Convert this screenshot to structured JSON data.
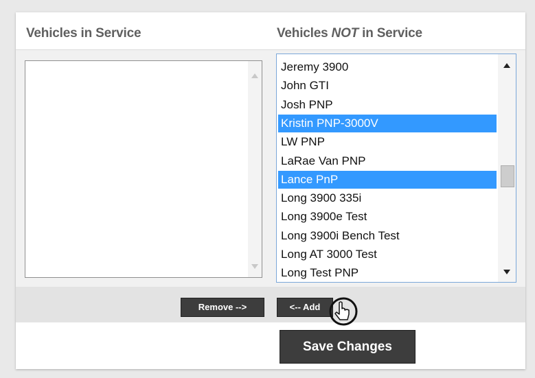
{
  "header": {
    "in_service_title": "Vehicles in Service",
    "not_in_service_prefix": "Vehicles ",
    "not_in_service_em": "NOT",
    "not_in_service_suffix": " in Service"
  },
  "in_service_list": {
    "items": []
  },
  "not_in_service_list": {
    "items": [
      {
        "label": "Jeremy 3900",
        "selected": false
      },
      {
        "label": "John GTI",
        "selected": false
      },
      {
        "label": "Josh PNP",
        "selected": false
      },
      {
        "label": "Kristin PNP-3000V",
        "selected": true
      },
      {
        "label": "LW PNP",
        "selected": false
      },
      {
        "label": "LaRae Van PNP",
        "selected": false
      },
      {
        "label": "Lance PnP",
        "selected": true
      },
      {
        "label": "Long 3900 335i",
        "selected": false
      },
      {
        "label": "Long 3900e Test",
        "selected": false
      },
      {
        "label": "Long 3900i Bench Test",
        "selected": false
      },
      {
        "label": "Long AT 3000 Test",
        "selected": false
      },
      {
        "label": "Long Test PNP",
        "selected": false
      }
    ],
    "selection_color": "#3399ff",
    "scroll_position": 0.55
  },
  "buttons": {
    "remove_label": "Remove -->",
    "add_label": "<-- Add",
    "save_label": "Save Changes"
  },
  "icons": [
    "scroll-up-arrow-icon",
    "scroll-down-arrow-icon",
    "hand-pointer-cursor-icon"
  ]
}
